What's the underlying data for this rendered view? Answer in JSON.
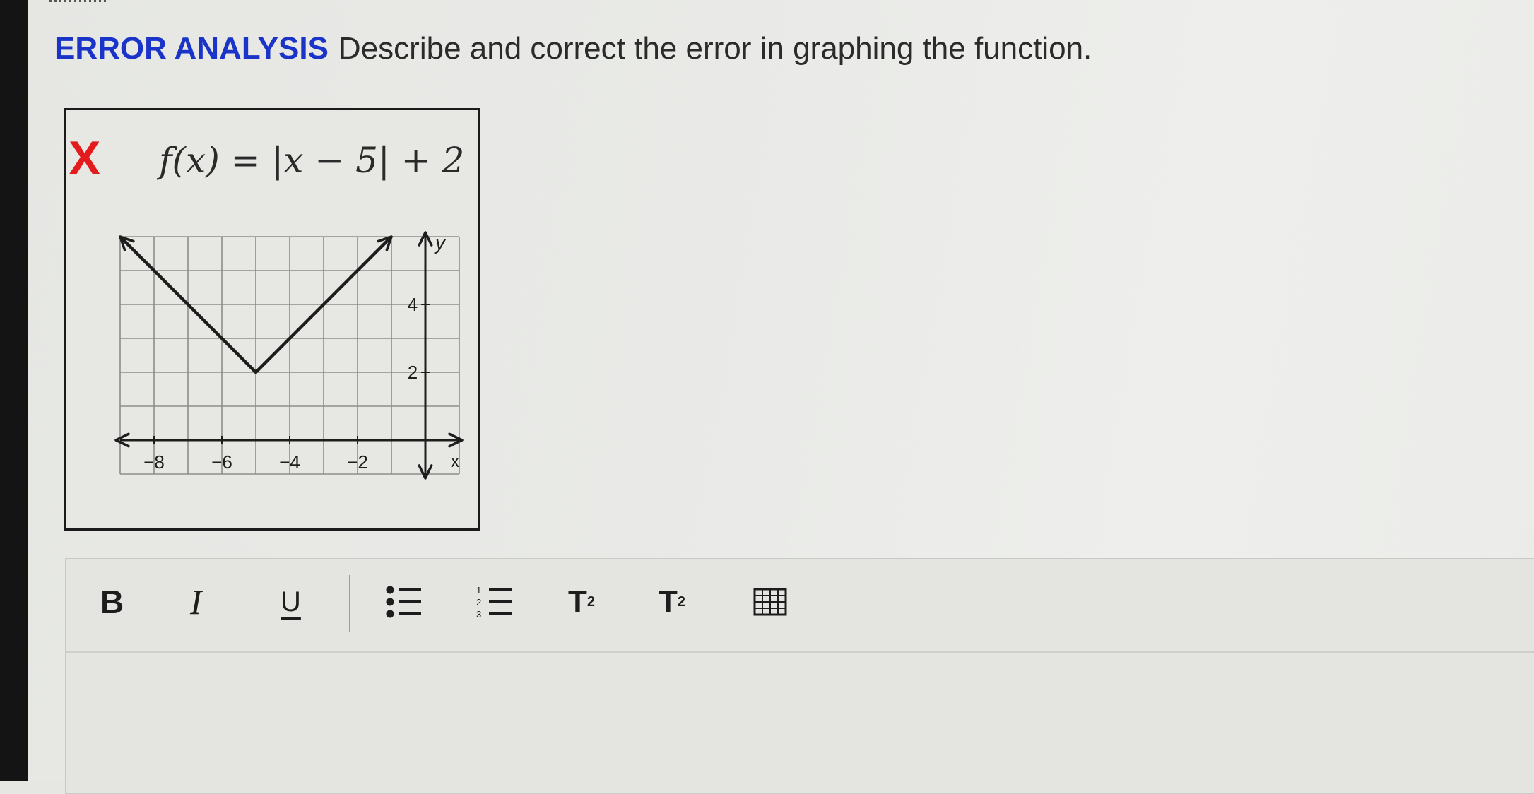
{
  "question": {
    "label": "ERROR ANALYSIS",
    "text": "Describe and correct the error in graphing the function."
  },
  "figure": {
    "error_mark": "X",
    "equation": "f(x) = |x − 5| + 2",
    "error_color": "#e21c1c"
  },
  "chart_data": {
    "type": "line",
    "title": "",
    "xlabel": "x",
    "ylabel": "y",
    "xlim": [
      -9,
      1
    ],
    "ylim": [
      -1,
      6
    ],
    "x_ticks": [
      -8,
      -6,
      -4,
      -2
    ],
    "y_ticks": [
      2,
      4
    ],
    "x_tick_labels": [
      "−8",
      "−6",
      "−4",
      "−2"
    ],
    "y_tick_labels": [
      "2",
      "4"
    ],
    "grid": true,
    "series": [
      {
        "x": [
          -9,
          -5,
          -1
        ],
        "y": [
          6,
          2,
          6
        ]
      }
    ]
  },
  "editor": {
    "toolbar": {
      "bold": "B",
      "italic": "I",
      "underline": "U",
      "superscript": "T",
      "superscript_mark": "2",
      "subscript": "T",
      "subscript_mark": "2"
    }
  },
  "icons": [
    "bulleted-list-icon",
    "numbered-list-icon",
    "table-icon"
  ],
  "colors": {
    "label_blue": "#1a33c8",
    "text": "#2b2b2b"
  }
}
